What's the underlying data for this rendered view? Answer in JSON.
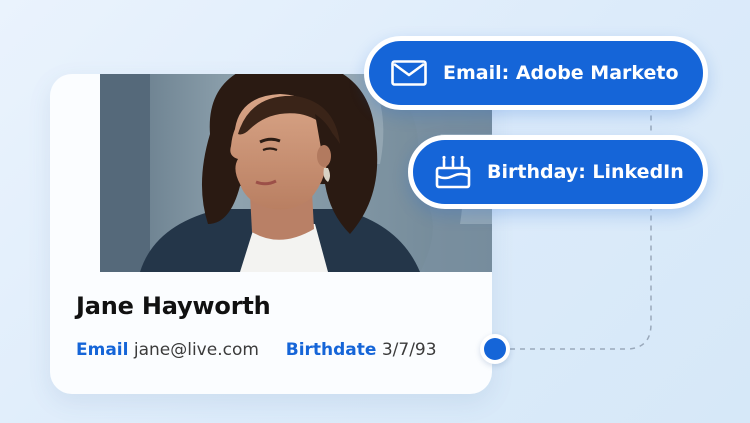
{
  "profile": {
    "name": "Jane Hayworth",
    "email_label": "Email",
    "email_value": "jane@live.com",
    "birthdate_label": "Birthdate",
    "birthdate_value": "3/7/93"
  },
  "sources": [
    {
      "label": "Email: Adobe Marketo",
      "icon": "envelope-icon"
    },
    {
      "label": "Birthday: LinkedIn",
      "icon": "birthday-cake-icon"
    }
  ],
  "colors": {
    "accent": "#1565d8",
    "background": "#e3effb",
    "card": "#fbfdff"
  }
}
